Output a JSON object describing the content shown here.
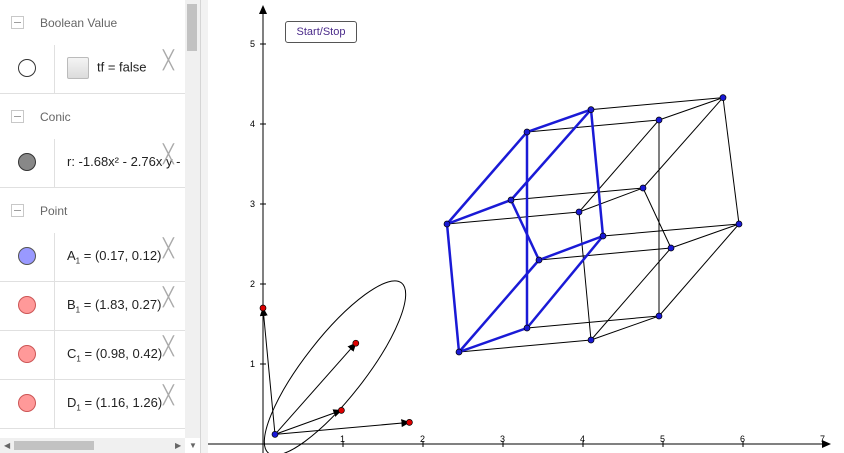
{
  "algebra": {
    "categories": {
      "boolean": "Boolean Value",
      "conic": "Conic",
      "point": "Point"
    },
    "items": {
      "tf": {
        "text": "tf = false"
      },
      "conic": {
        "text": "r: -1.68x² - 2.76x y -"
      },
      "A1": {
        "name": "A",
        "sub": "1",
        "value": " = (0.17, 0.12)",
        "color": "#9999ff"
      },
      "B1": {
        "name": "B",
        "sub": "1",
        "value": " = (1.83, 0.27)",
        "color": "#ff9999"
      },
      "C1": {
        "name": "C",
        "sub": "1",
        "value": " = (0.98, 0.42)",
        "color": "#ff9999"
      },
      "D1": {
        "name": "D",
        "sub": "1",
        "value": " = (1.16, 1.26)",
        "color": "#ff9999"
      }
    },
    "icons": {
      "close": "close-icon",
      "collapse": "collapse-icon"
    }
  },
  "button": {
    "label": "Start/Stop"
  },
  "axes": {
    "x_ticks": [
      "1",
      "2",
      "3",
      "4",
      "5",
      "6",
      "7"
    ],
    "y_ticks": [
      "1",
      "2",
      "3",
      "4",
      "5"
    ]
  },
  "figure": {
    "triangle_vertices": [
      [
        0.0,
        1.7
      ],
      [
        0.15,
        0.12
      ],
      [
        1.83,
        0.27
      ]
    ],
    "triangle_inner_points": [
      [
        0.98,
        0.42
      ],
      [
        1.16,
        1.26
      ]
    ],
    "ellipse_center": [
      0.9,
      0.95
    ],
    "ellipse_semi_axes": [
      1.35,
      0.38
    ],
    "ellipse_angle_deg": -52,
    "front_cube": [
      [
        2.3,
        2.75
      ],
      [
        3.3,
        3.9
      ],
      [
        4.1,
        4.18
      ],
      [
        3.1,
        3.05
      ],
      [
        2.45,
        1.15
      ],
      [
        3.3,
        1.45
      ],
      [
        4.25,
        2.6
      ],
      [
        3.45,
        2.3
      ]
    ],
    "back_cube": [
      [
        3.95,
        2.9
      ],
      [
        4.95,
        4.05
      ],
      [
        5.75,
        4.33
      ],
      [
        4.75,
        3.2
      ],
      [
        4.1,
        1.3
      ],
      [
        4.95,
        1.6
      ],
      [
        5.95,
        2.75
      ],
      [
        5.1,
        2.45
      ]
    ]
  },
  "colors": {
    "blue": "#1a1ad6",
    "red": "#dd0000",
    "point_blue": "#1a1ad6"
  }
}
